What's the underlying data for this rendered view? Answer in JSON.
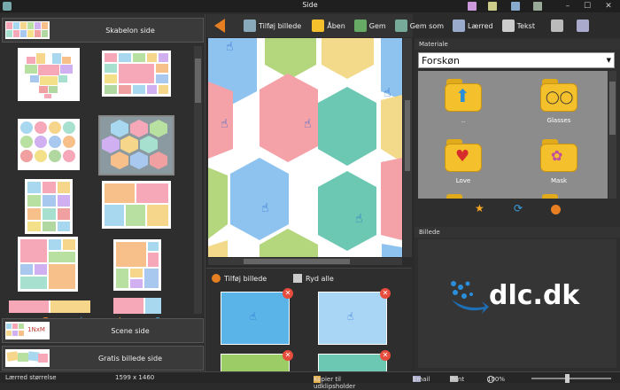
{
  "window": {
    "title": "Side"
  },
  "toolbar": {
    "add_image": "Tilføj billede",
    "open": "Åben",
    "save": "Gem",
    "save_as": "Gem som",
    "canvas": "Lærred",
    "text": "Tekst"
  },
  "left_panel": {
    "template_section": "Skabelon side",
    "scene_section": "Scene side",
    "free_section": "Gratis billede side",
    "scene_thumb_text": "1NxM"
  },
  "image_panel": {
    "add_image": "Tilføj billede",
    "clear_all": "Ryd alle"
  },
  "right_panel": {
    "material_header": "Materiale",
    "material_category": "Forskøn",
    "materials": [
      {
        "label": "..",
        "icon": "arrow-up-icon"
      },
      {
        "label": "Glasses",
        "icon": "glasses-icon"
      },
      {
        "label": "Love",
        "icon": "heart-icon"
      },
      {
        "label": "Mask",
        "icon": "mask-icon"
      }
    ],
    "image_header": "Billede",
    "logo_text": "dlc.dk"
  },
  "statusbar": {
    "canvas_size_label": "Lærred størrelse",
    "canvas_size_value": "1599 x 1460",
    "copy_clipboard": "Kopier til udklipsholder",
    "email": "Email",
    "print": "Print",
    "zoom": "100%"
  },
  "colors": {
    "accent_orange": "#e67e22",
    "hex_pink": "#f4a1a8",
    "hex_blue": "#8fc3ef",
    "hex_teal": "#6cc8b2",
    "hex_yellow": "#f3d98a",
    "hex_green": "#b4d77e",
    "folder_yellow": "#f4c02b"
  }
}
